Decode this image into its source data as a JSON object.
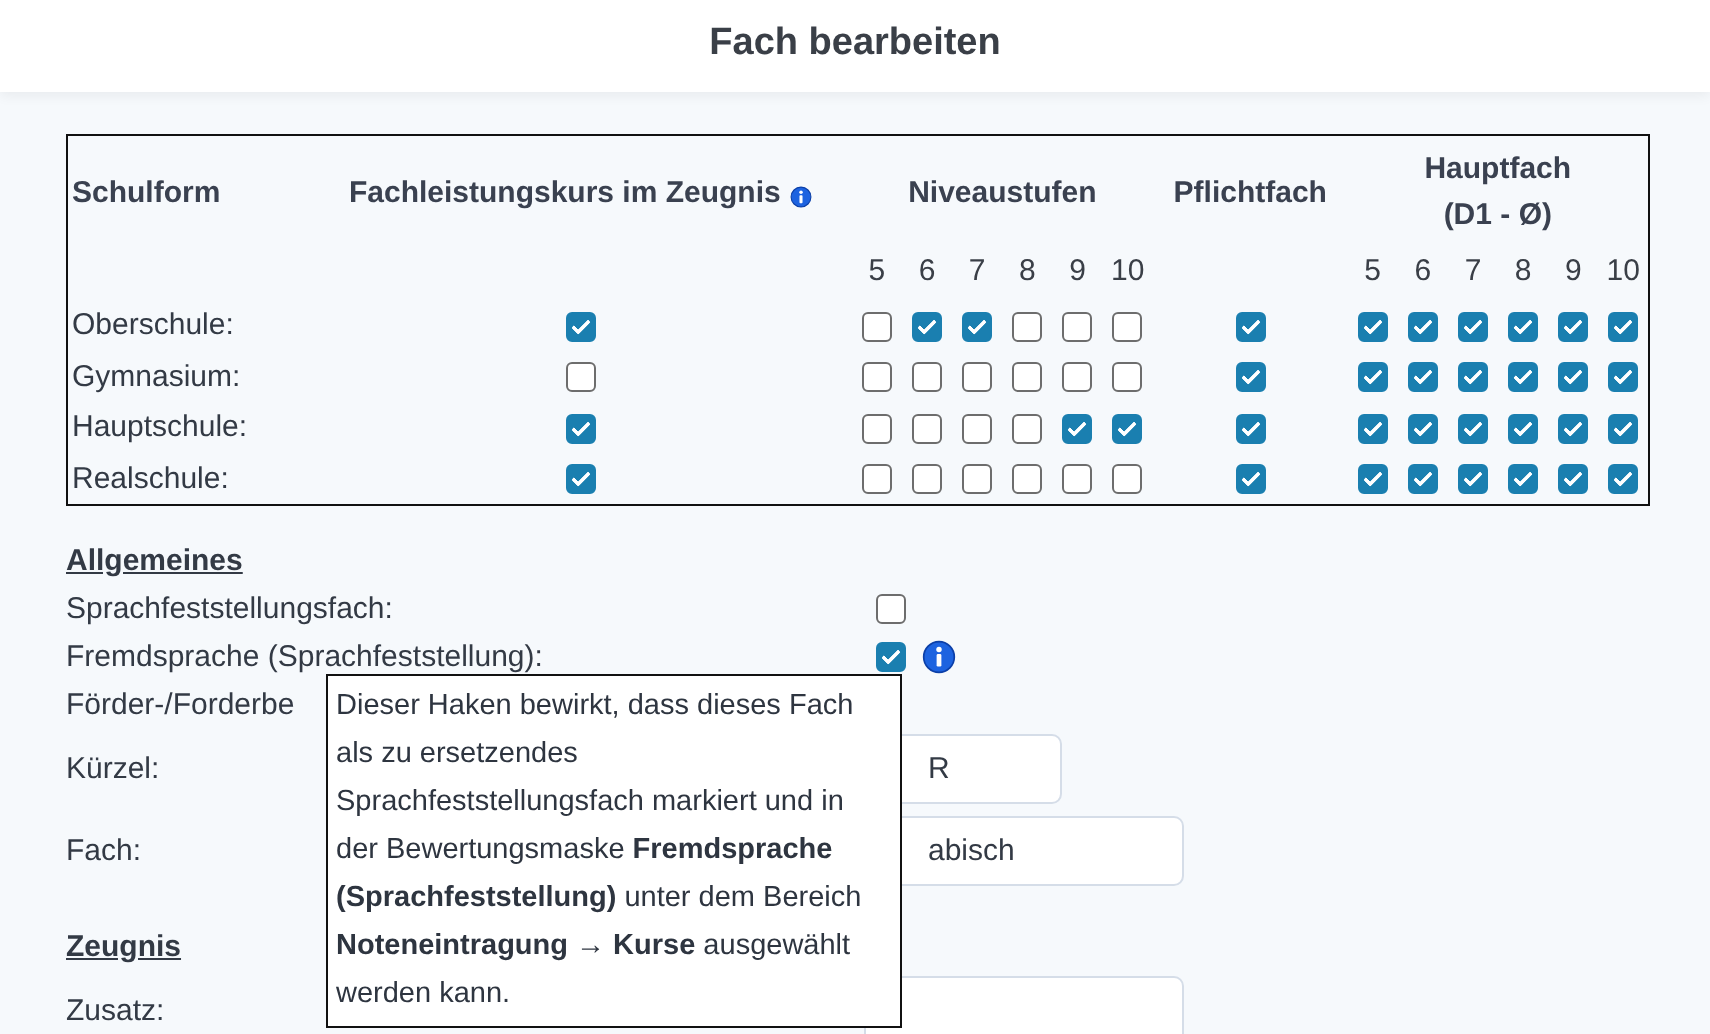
{
  "title": "Fach bearbeiten",
  "table": {
    "columns": [
      {
        "label": "Schulform"
      },
      {
        "label": "Fachleistungskurs im Zeugnis",
        "info": true
      },
      {
        "label": "Niveaustufen"
      },
      {
        "label": "Pflichtfach"
      },
      {
        "label": "Hauptfach",
        "sublabel": "(D1 - Ø)"
      }
    ],
    "niveau_grades": [
      "5",
      "6",
      "7",
      "8",
      "9",
      "10"
    ],
    "hauptfach_grades": [
      "5",
      "6",
      "7",
      "8",
      "9",
      "10"
    ],
    "rows": [
      {
        "schulform": "Oberschule:",
        "fachleistungskurs": true,
        "niveau": [
          false,
          true,
          true,
          false,
          false,
          false
        ],
        "pflichtfach": true,
        "hauptfach": [
          true,
          true,
          true,
          true,
          true,
          true
        ]
      },
      {
        "schulform": "Gymnasium:",
        "fachleistungskurs": false,
        "niveau": [
          false,
          false,
          false,
          false,
          false,
          false
        ],
        "pflichtfach": true,
        "hauptfach": [
          true,
          true,
          true,
          true,
          true,
          true
        ]
      },
      {
        "schulform": "Hauptschule:",
        "fachleistungskurs": true,
        "niveau": [
          false,
          false,
          false,
          false,
          true,
          true
        ],
        "pflichtfach": true,
        "hauptfach": [
          true,
          true,
          true,
          true,
          true,
          true
        ]
      },
      {
        "schulform": "Realschule:",
        "fachleistungskurs": true,
        "niveau": [
          false,
          false,
          false,
          false,
          false,
          false
        ],
        "pflichtfach": true,
        "hauptfach": [
          true,
          true,
          true,
          true,
          true,
          true
        ]
      }
    ]
  },
  "sections": [
    {
      "heading": "Allgemeines",
      "fields": [
        {
          "kind": "checkbox",
          "label": "Sprachfeststellungsfach:",
          "checked": false
        },
        {
          "kind": "checkbox",
          "label": "Fremdsprache (Sprachfeststellung):",
          "checked": true,
          "info": true
        },
        {
          "kind": "label",
          "label": "Förder-/Forderbe"
        },
        {
          "kind": "code",
          "label": "Kürzel:",
          "value": "R"
        },
        {
          "kind": "text",
          "label": "Fach:",
          "value": "abisch"
        }
      ]
    },
    {
      "heading": "Zeugnis",
      "fields": [
        {
          "kind": "text",
          "label": "Zusatz:"
        }
      ]
    }
  ],
  "tooltip": {
    "text": "Dieser Haken bewirkt, dass dieses Fach als zu ersetzendes Sprachfeststellungsfach markiert und in der Bewertungsmaske **Fremdsprache (Sprachfeststellung)** unter dem Bereich **Noteneintragung → Kurse** ausgewählt werden kann."
  }
}
